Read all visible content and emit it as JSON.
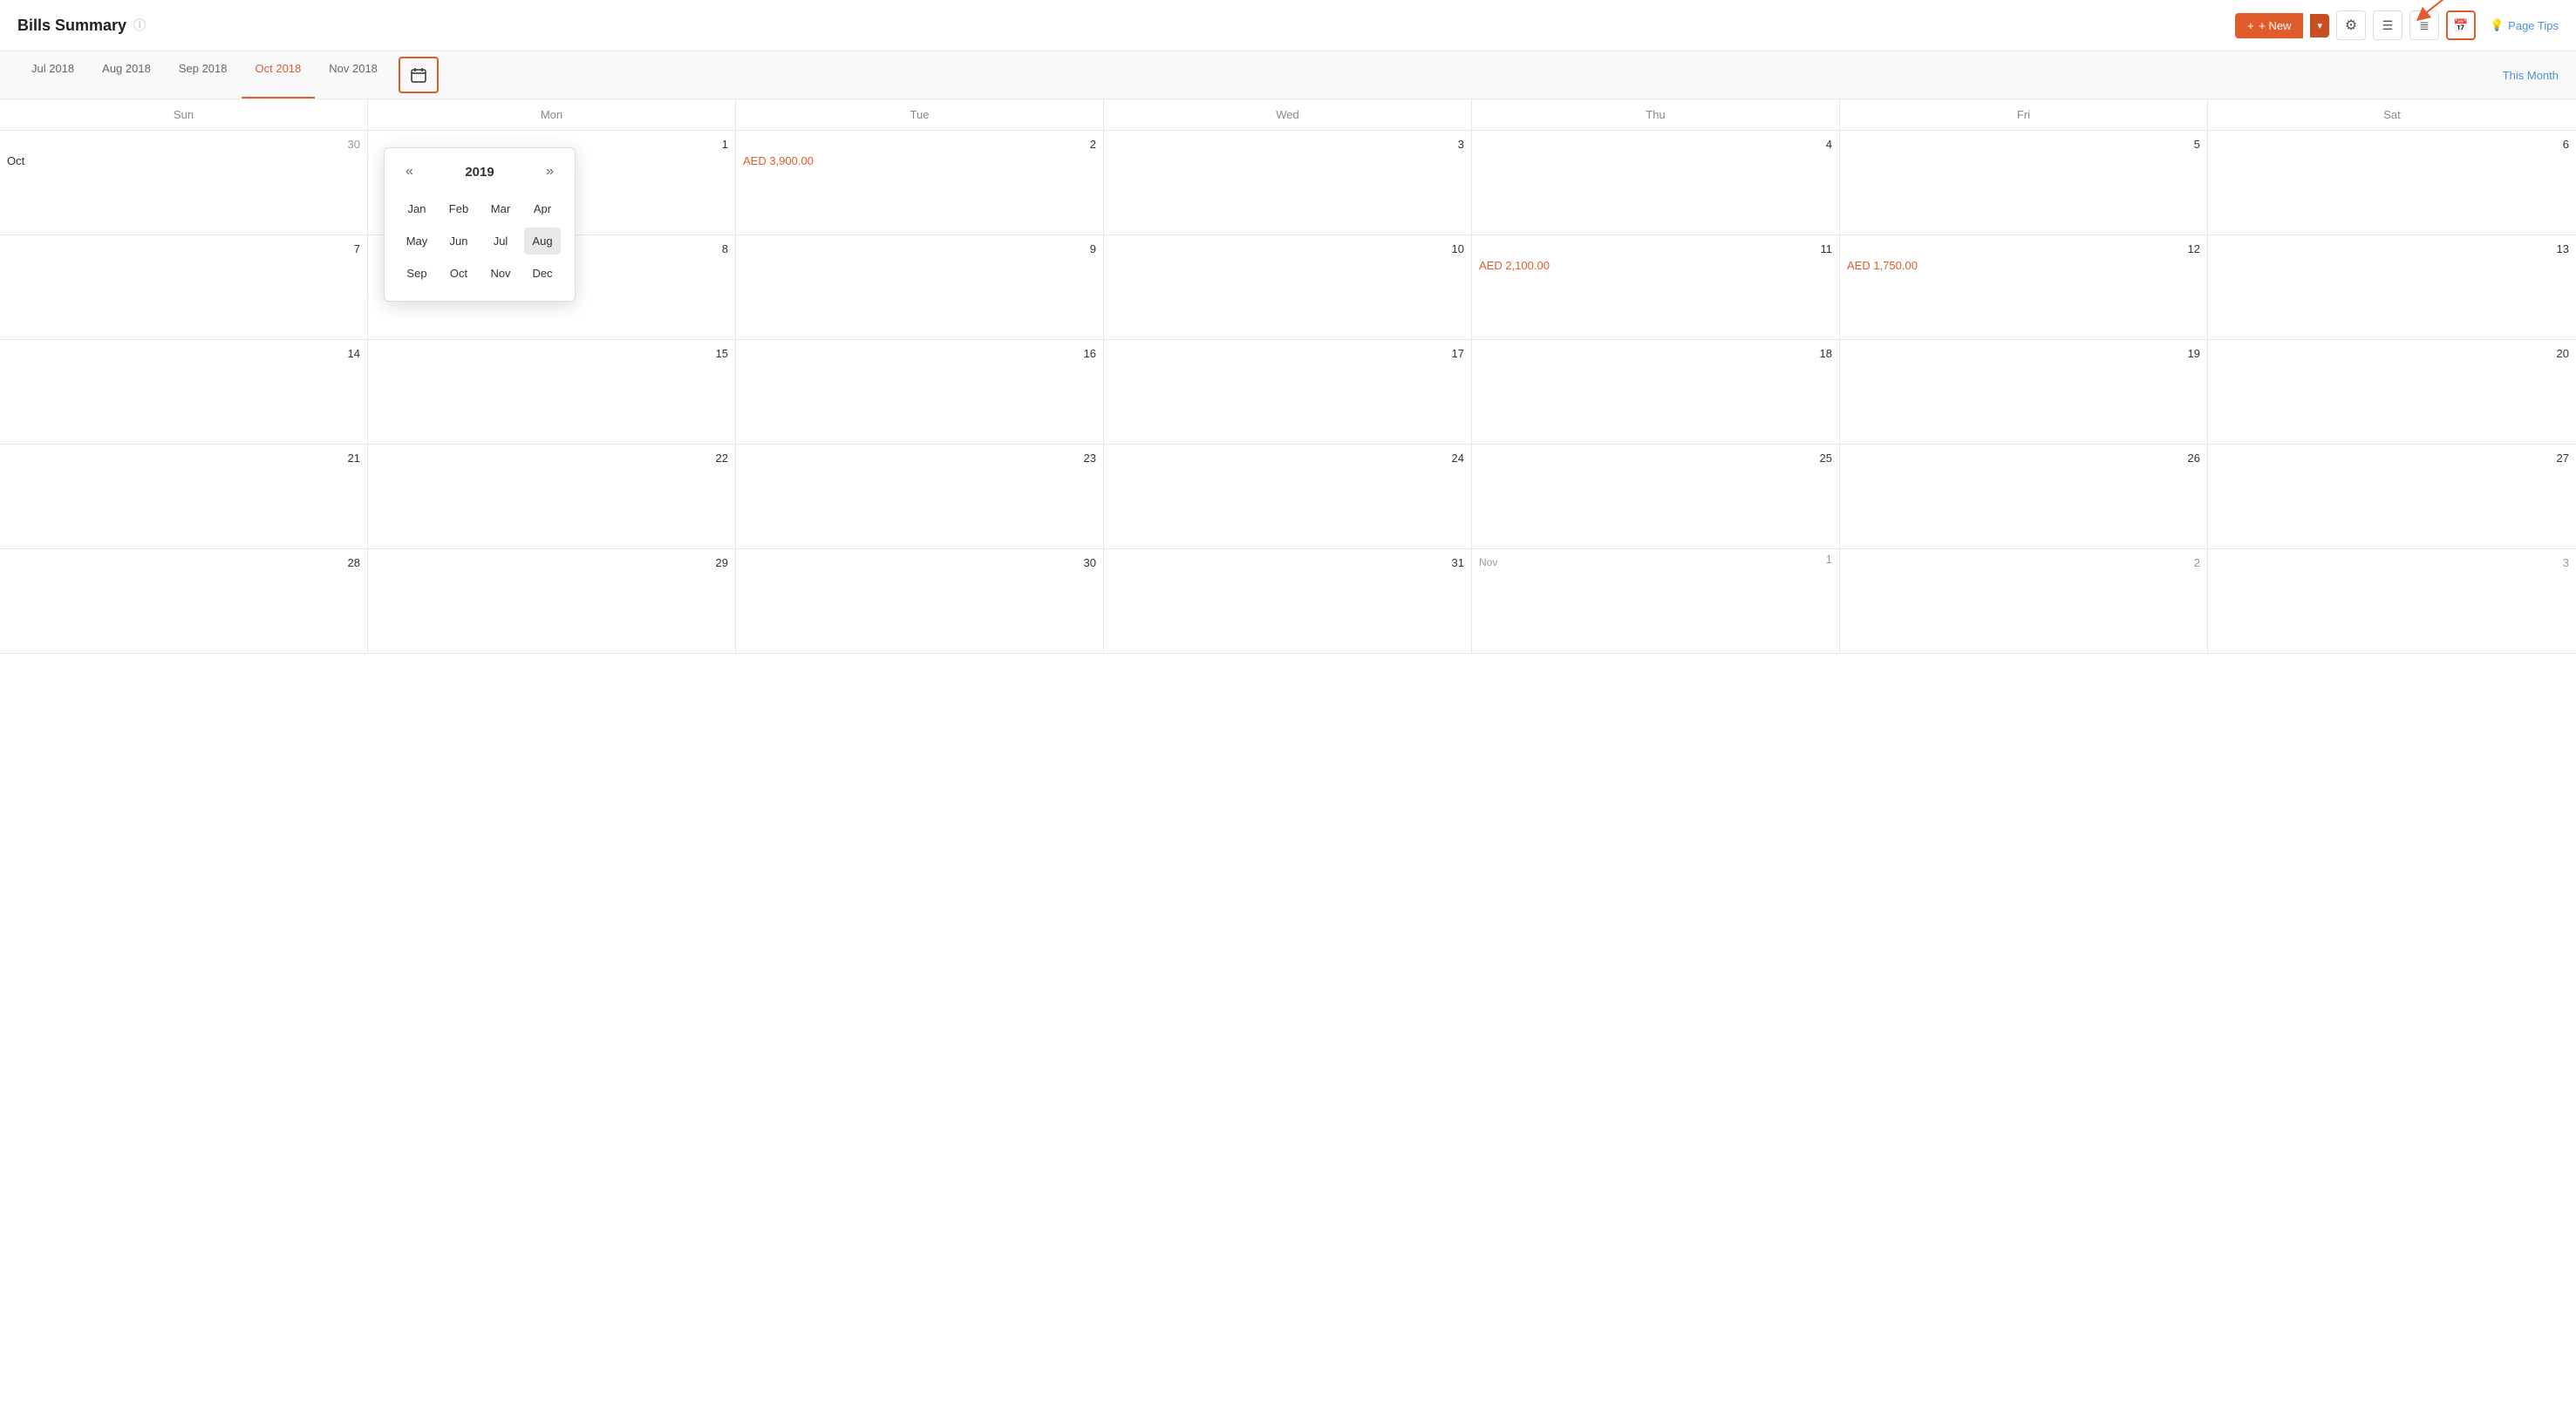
{
  "page": {
    "title": "Bills Summary",
    "help_icon": "?"
  },
  "header": {
    "new_button_label": "+ New",
    "settings_icon": "⚙",
    "list_icon": "☰",
    "grid_icon": "▦",
    "calendar_icon": "📅",
    "page_tips_label": "Page Tips"
  },
  "month_tabs": [
    {
      "id": "jul2018",
      "label": "Jul 2018",
      "active": false
    },
    {
      "id": "aug2018",
      "label": "Aug 2018",
      "active": false
    },
    {
      "id": "sep2018",
      "label": "Sep 2018",
      "active": false
    },
    {
      "id": "oct2018",
      "label": "Oct 2018",
      "active": true
    },
    {
      "id": "nov2018",
      "label": "Nov 2018",
      "active": false
    }
  ],
  "this_month_label": "This Month",
  "calendar": {
    "day_headers": [
      "Sun",
      "Mon",
      "Tue",
      "Wed",
      "Thu",
      "Fri",
      "Sat"
    ],
    "year": "2019",
    "months": [
      "Jan",
      "Feb",
      "Mar",
      "Apr",
      "May",
      "Jun",
      "Jul",
      "Aug",
      "Sep",
      "Oct",
      "Nov",
      "Dec"
    ],
    "selected_month": "Aug",
    "nav_prev": "«",
    "nav_next": "»",
    "cells": [
      {
        "number": "30",
        "type": "prev-month",
        "month_label": "Oct",
        "amount": ""
      },
      {
        "number": "1",
        "type": "current",
        "amount": ""
      },
      {
        "number": "2",
        "type": "current",
        "amount": ""
      },
      {
        "number": "3",
        "type": "current",
        "amount": ""
      },
      {
        "number": "4",
        "type": "current",
        "amount": ""
      },
      {
        "number": "5",
        "type": "current",
        "amount": ""
      },
      {
        "number": "6",
        "type": "current",
        "amount": ""
      },
      {
        "number": "7",
        "type": "current",
        "amount": ""
      },
      {
        "number": "8",
        "type": "current",
        "amount": ""
      },
      {
        "number": "9",
        "type": "current",
        "amount": ""
      },
      {
        "number": "10",
        "type": "current",
        "amount": ""
      },
      {
        "number": "11",
        "type": "current",
        "amount": "AED 2,100.00"
      },
      {
        "number": "12",
        "type": "current",
        "amount": "AED 1,750.00"
      },
      {
        "number": "13",
        "type": "current",
        "amount": ""
      },
      {
        "number": "14",
        "type": "current",
        "amount": ""
      },
      {
        "number": "15",
        "type": "current",
        "amount": ""
      },
      {
        "number": "16",
        "type": "current",
        "amount": ""
      },
      {
        "number": "17",
        "type": "current",
        "amount": ""
      },
      {
        "number": "18",
        "type": "current",
        "amount": ""
      },
      {
        "number": "19",
        "type": "current",
        "amount": ""
      },
      {
        "number": "20",
        "type": "current",
        "amount": ""
      },
      {
        "number": "21",
        "type": "current",
        "amount": ""
      },
      {
        "number": "22",
        "type": "current",
        "amount": ""
      },
      {
        "number": "23",
        "type": "current",
        "amount": ""
      },
      {
        "number": "24",
        "type": "current",
        "amount": ""
      },
      {
        "number": "25",
        "type": "current",
        "amount": ""
      },
      {
        "number": "26",
        "type": "current",
        "amount": ""
      },
      {
        "number": "27",
        "type": "current",
        "amount": ""
      },
      {
        "number": "28",
        "type": "current",
        "amount": ""
      },
      {
        "number": "29",
        "type": "current",
        "amount": ""
      },
      {
        "number": "30",
        "type": "current",
        "amount": ""
      },
      {
        "number": "31",
        "type": "current",
        "amount": ""
      },
      {
        "number": "1",
        "type": "next-month",
        "month_label": "Nov",
        "amount": ""
      },
      {
        "number": "2",
        "type": "next-month",
        "amount": ""
      },
      {
        "number": "3",
        "type": "next-month",
        "amount": ""
      }
    ],
    "week2_amount": "AED 3,900.00"
  }
}
